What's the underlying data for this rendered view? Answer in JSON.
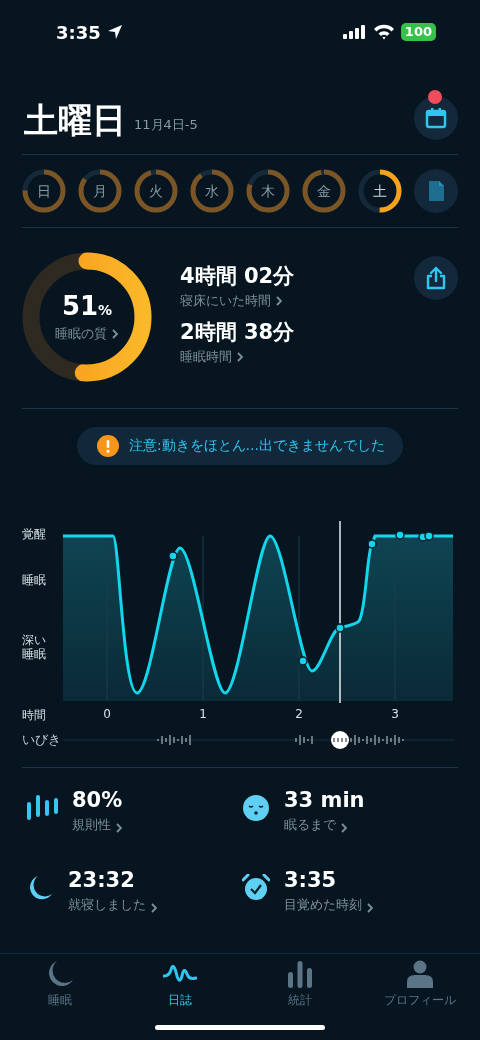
{
  "status_bar": {
    "time": "3:35",
    "battery": "100"
  },
  "header": {
    "title": "土曜日",
    "date": "11月4日-5",
    "calendar_badge": true
  },
  "week": [
    {
      "label": "日",
      "selected": false
    },
    {
      "label": "月",
      "selected": false
    },
    {
      "label": "火",
      "selected": false
    },
    {
      "label": "水",
      "selected": false
    },
    {
      "label": "木",
      "selected": false
    },
    {
      "label": "金",
      "selected": false
    },
    {
      "label": "土",
      "selected": true
    }
  ],
  "summary": {
    "quality": {
      "value": "51",
      "unit": "%",
      "label": "睡眠の質"
    },
    "stats": [
      {
        "value": "4時間 02分",
        "label": "寝床にいた時間"
      },
      {
        "value": "2時間 38分",
        "label": "睡眠時間"
      }
    ]
  },
  "warning": "注意:動きをほとん…出できませんでした",
  "chart": {
    "y_labels": [
      "覚醒",
      "睡眠",
      "深い睡眠"
    ],
    "x_title": "時間",
    "x_ticks": [
      "0",
      "1",
      "2",
      "3"
    ],
    "snore_label": "いびき"
  },
  "metrics": [
    {
      "kind": "regularity",
      "value": "80%",
      "label": "規則性"
    },
    {
      "kind": "fall_asleep",
      "value": "33 min",
      "label": "眠るまで"
    },
    {
      "kind": "bedtime",
      "value": "23:32",
      "label": "就寝しました"
    },
    {
      "kind": "wake",
      "value": "3:35",
      "label": "目覚めた時刻"
    }
  ],
  "tabs": [
    {
      "kind": "sleep",
      "label": "睡眠",
      "selected": false
    },
    {
      "kind": "journal",
      "label": "日誌",
      "selected": true
    },
    {
      "kind": "stats",
      "label": "統計",
      "selected": false
    },
    {
      "kind": "profile",
      "label": "プロフィール",
      "selected": false
    }
  ]
}
